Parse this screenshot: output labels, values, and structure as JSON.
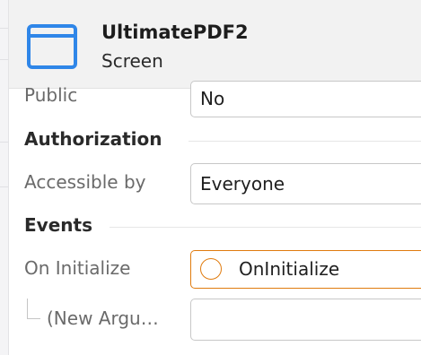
{
  "header": {
    "title": "UltimatePDF2",
    "subtitle": "Screen",
    "icon": "screen-window-icon",
    "icon_color": "#2f86e8"
  },
  "properties": {
    "public": {
      "label": "Public",
      "value": "No"
    },
    "authorization_heading": "Authorization",
    "accessible_by": {
      "label": "Accessible by",
      "value": "Everyone"
    },
    "events_heading": "Events",
    "on_initialize": {
      "label": "On Initialize",
      "value": "OnInitialize",
      "icon": "event-circle-icon",
      "accent": "#e07b0e"
    },
    "new_argument": {
      "label": "(New Argu…",
      "value": ""
    }
  }
}
